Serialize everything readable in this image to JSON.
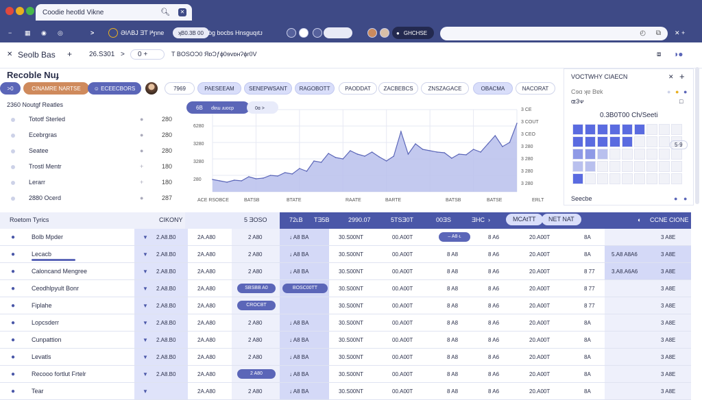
{
  "window": {
    "tab_title": "Coodie heotld Vikne",
    "dot_colors": [
      "#e0493d",
      "#e9b020",
      "#48b84a"
    ]
  },
  "toolbar": {
    "nav_icons": [
      "minus-icon",
      "grid-icon",
      "eye-icon",
      "target-icon"
    ],
    "arrow": ">",
    "info_text": "ƏIΛBJ  ƎT  Ɩᴬɲne",
    "pill": "ʞB0.3B 00",
    "desc": "ɓɡ bocbs Hnsguqıtᴊ",
    "dark_pill": "GHCHSE",
    "omni_icons": [
      "clock-icon",
      "copy-icon"
    ],
    "right_icon": "✕   +"
  },
  "subbar": {
    "close": "✕",
    "title": "Seolb Bas",
    "plus": "+",
    "code": "26.S301",
    "chev": ">",
    "ctrl": "0 +",
    "path": "T BOSOƆ0  ЯɒƆƒɸ0ɘvɒʜɁɸr0V"
  },
  "page": {
    "title": "Recoble Nuɟ",
    "chips": [
      {
        "label": ">0",
        "style": "blue"
      },
      {
        "label": "CINAMRE NARTSE",
        "style": "orange"
      },
      {
        "label": "☺ ECEECBORS",
        "style": "blue"
      },
      {
        "label": "7969",
        "style": "white"
      },
      {
        "label": "PAESEEAM",
        "style": "light"
      },
      {
        "label": "SENEPWSANT",
        "style": "light"
      },
      {
        "label": "RAGOBOTT",
        "style": "light"
      },
      {
        "label": "PAODDAT",
        "style": "white"
      },
      {
        "label": "ZACBEBCS",
        "style": "white"
      },
      {
        "label": "ZNSZAGACE",
        "style": "white"
      },
      {
        "label": "OBACMA",
        "style": "light"
      },
      {
        "label": "NACORAT",
        "style": "white"
      }
    ]
  },
  "left_panel": {
    "header": "2360 Noutgf Reatles",
    "rows": [
      {
        "label": "Tototf Sterled",
        "value": "280"
      },
      {
        "label": "Ecebrgras",
        "value": "280"
      },
      {
        "label": "Seatee",
        "value": "280"
      },
      {
        "label": "Trostl Mentr",
        "value": "180"
      },
      {
        "label": "Lerarr",
        "value": "180"
      },
      {
        "label": "2880 Ocerd",
        "value": "287"
      }
    ]
  },
  "chart": {
    "legend_badge": "6B",
    "legend_label": "ɗɐɯ ɹuocp",
    "legend_right": "0ɑ >",
    "x_ticks": [
      "ACE RSOBCE",
      "BATSB",
      "BTATE",
      "RAATE",
      "BARTE",
      "BATSB",
      "BATSE",
      "ERLT"
    ],
    "y_left_ticks": [
      "6280",
      "3280",
      "3280",
      "280"
    ],
    "y_right_ticks": [
      "3 CE",
      "3 COUT",
      "3 CEO",
      "3 280",
      "3 280",
      "3 280",
      "3 280"
    ],
    "fill_color": "#b8c0ec",
    "line_color": "#5b66b8"
  },
  "chart_data": {
    "type": "area",
    "x": [
      "ACE RSOBCE",
      "BATSB",
      "BTATE",
      "RAATE",
      "BARTE",
      "BATSB",
      "BATSE",
      "ERLT"
    ],
    "series": [
      {
        "values": [
          18,
          16,
          14,
          17,
          16,
          22,
          19,
          20,
          24,
          23,
          28,
          26,
          34,
          30,
          45,
          43,
          56,
          50,
          48,
          60,
          55,
          52,
          58,
          51,
          45,
          52,
          88,
          55,
          70,
          62,
          60,
          58,
          57,
          49,
          55,
          54,
          62,
          58,
          70,
          82,
          66,
          72,
          100
        ]
      }
    ],
    "ylim": [
      0,
      120
    ]
  },
  "right_panel": {
    "title": "VOCTWHY CIAECN",
    "plus": "+",
    "sub1": "Cɘɑ ʞɐ Bɐk",
    "sub2": "ɶ3ᴪ",
    "big": "0.3B0T00 Ch/Seeti",
    "badge": "5·9",
    "footer": "Seecbe",
    "dot_colors": [
      "#cdd2e8",
      "#e9b020",
      "#5b66b8"
    ]
  },
  "table": {
    "head_left": "Roetom Tyrics",
    "head_col2": "CIKONY",
    "head_cols": [
      "5 ƎOSO",
      "72ʟB",
      "TƎ5B",
      "2990.07",
      "5TSƎ0T",
      "00ƎS",
      "ƎHC"
    ],
    "head_buttons": [
      "MCAtTT",
      "NET NAT"
    ],
    "head_right": "CCNE CIONE",
    "rows": [
      {
        "name": "Bolb Mpder",
        "c1": "2.A8.B0",
        "c2": "2A.A80",
        "c3": "2 A80",
        "c4": "↓ A8 BA",
        "c5": "30.S00NT",
        "c6": "00.A00T",
        "c7": "",
        "c8": "8 A6",
        "c9": "20.A00T",
        "c10": "8A",
        "c11": "",
        "c12": "3 A8E",
        "pill7": "– A8·ʟ"
      },
      {
        "name": "Lecacb",
        "c1": "2.A8.B0",
        "c2": "2A.A80",
        "c3": "2 A80",
        "c4": "↓ A8 BA",
        "c5": "30.S00NT",
        "c6": "00.A00T",
        "c7": "8 A8",
        "c8": "8 A6",
        "c9": "20.A00T",
        "c10": "8A",
        "c11": "5.A8 A8A6",
        "c12": "3 A8E"
      },
      {
        "name": "Caloncand Mengree",
        "c1": "2.A8.B0",
        "c2": "2A.A80",
        "c3": "2 A80",
        "c4": "↓ A8 BA",
        "c5": "30.S00NT",
        "c6": "00.A00T",
        "c7": "8 A8",
        "c8": "8 A6",
        "c9": "20.A00T",
        "c10": "8 77",
        "c11": "3.A8.A6A6",
        "c12": "3 A8E"
      },
      {
        "name": "Ceodhlpyult Bonr",
        "c1": "2.A8.B0",
        "c2": "2A.A80",
        "c3": "",
        "c4": "",
        "c5": "30.S00NT",
        "c6": "00.A00T",
        "c7": "8 A8",
        "c8": "8 A6",
        "c9": "20.A00T",
        "c10": "8 77",
        "c11": "",
        "c12": "3 A8E",
        "pill3": "SBSBB A0",
        "pill4": "BOSC00TT"
      },
      {
        "name": "Fiplahe",
        "c1": "2.A8.B0",
        "c2": "2A.A80",
        "c3": "",
        "c4": "",
        "c5": "30.S00NT",
        "c6": "00.A00T",
        "c7": "8 A8",
        "c8": "8 A6",
        "c9": "20.A00T",
        "c10": "8 77",
        "c11": "",
        "c12": "3 A8E",
        "pill3": "CROCBT"
      },
      {
        "name": "Lopcsderr",
        "c1": "2.A8.B0",
        "c2": "2A.A80",
        "c3": "2 A80",
        "c4": "↓ A8 BA",
        "c5": "30.S00NT",
        "c6": "00.A00T",
        "c7": "8 A8",
        "c8": "8 A6",
        "c9": "20.A00T",
        "c10": "8A",
        "c11": "",
        "c12": "3 A8E"
      },
      {
        "name": "Cunpattion",
        "c1": "2.A8.B0",
        "c2": "2A.A80",
        "c3": "2 A80",
        "c4": "↓ A8 BA",
        "c5": "30.S00NT",
        "c6": "00.A00T",
        "c7": "8 A8",
        "c8": "8 A6",
        "c9": "20.A00T",
        "c10": "8A",
        "c11": "",
        "c12": "3 A8E"
      },
      {
        "name": "Levatls",
        "c1": "2.A8.B0",
        "c2": "2A.A80",
        "c3": "2 A80",
        "c4": "↓ A8 BA",
        "c5": "30.S00NT",
        "c6": "00.A00T",
        "c7": "8 A8",
        "c8": "8 A6",
        "c9": "20.A00T",
        "c10": "8A",
        "c11": "",
        "c12": "3 A8E"
      },
      {
        "name": "Recooo fortlut Frtelr",
        "c1": "2.A8.B0",
        "c2": "2A.A80",
        "c3": "",
        "c4": "↓ A8 BA",
        "c5": "30.S00NT",
        "c6": "00.A00T",
        "c7": "8 A8",
        "c8": "8 A6",
        "c9": "20.A00T",
        "c10": "8A",
        "c11": "",
        "c12": "3 A8E",
        "pill3": "2 A80"
      },
      {
        "name": "Tear",
        "c1": "",
        "c2": "2A.A80",
        "c3": "2 A80",
        "c4": "↓ A8 BA",
        "c5": "30.S00NT",
        "c6": "00.A00T",
        "c7": "8 A8",
        "c8": "8 A6",
        "c9": "20.A00T",
        "c10": "8A",
        "c11": "",
        "c12": "3 A8E"
      }
    ]
  }
}
